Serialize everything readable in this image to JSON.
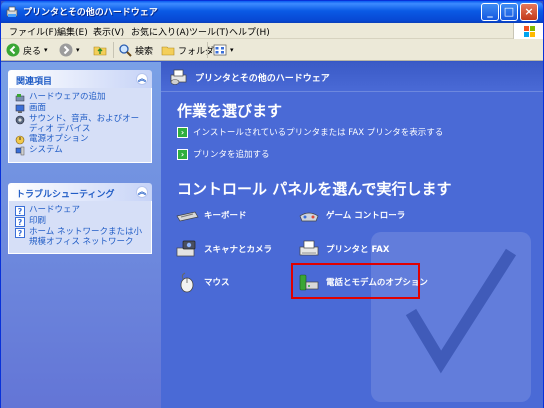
{
  "window": {
    "title": "プリンタとその他のハードウェア",
    "controls": {
      "minimize": "_",
      "maximize": "□",
      "close": "×"
    }
  },
  "menubar": {
    "items": [
      "ファイル(F)",
      "編集(E)",
      "表示(V)",
      "お気に入り(A)",
      "ツール(T)",
      "ヘルプ(H)"
    ]
  },
  "toolbar": {
    "back": "戻る",
    "search": "検索",
    "folders": "フォルダ"
  },
  "taskpane": {
    "related": {
      "title": "関連項目",
      "items": [
        "ハードウェアの追加",
        "画面",
        "サウンド、音声、およびオーディオ デバイス",
        "電源オプション",
        "システム"
      ]
    },
    "troubleshoot": {
      "title": "トラブルシューティング",
      "items": [
        "ハードウェア",
        "印刷",
        "ホーム ネットワークまたは小規模オフィス ネットワーク"
      ]
    }
  },
  "content": {
    "header_title": "プリンタとその他のハードウェア",
    "pick_task_title": "作業を選びます",
    "tasks": [
      "インストールされているプリンタまたは FAX プリンタを表示する",
      "プリンタを追加する"
    ],
    "pick_cp_title": "コントロール パネルを選んで実行します",
    "control_panels": [
      "キーボード",
      "ゲーム コントローラ",
      "スキャナとカメラ",
      "プリンタと FAX",
      "マウス",
      "電話とモデムのオプション"
    ]
  },
  "colors": {
    "accent": "#215dc6",
    "content_bg": "#4a6ad6",
    "highlight": "#e00000"
  }
}
